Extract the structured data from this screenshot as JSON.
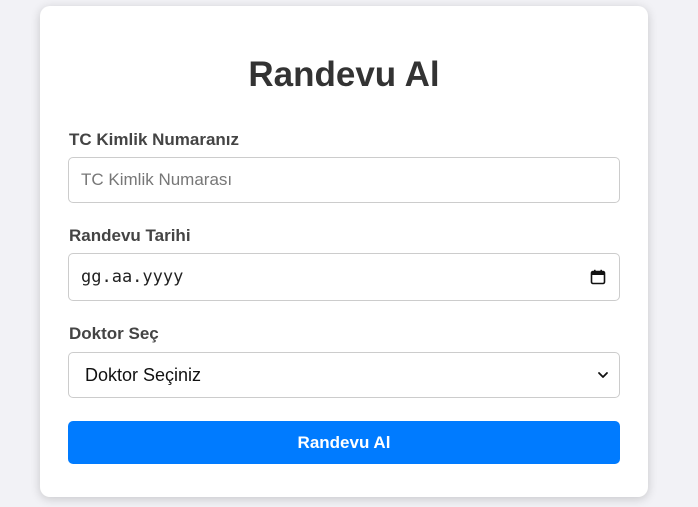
{
  "form": {
    "title": "Randevu Al",
    "tc_label": "TC Kimlik Numaranız",
    "tc_placeholder": "TC Kimlik Numarası",
    "tc_value": "",
    "date_label": "Randevu Tarihi",
    "date_placeholder": "gg.aa.yyyy",
    "doctor_label": "Doktor Seç",
    "doctor_selected": "Doktor Seçiniz",
    "submit_label": "Randevu Al"
  },
  "icons": {
    "date": "calendar-icon",
    "select": "chevron-down-icon"
  },
  "colors": {
    "accent": "#007bff",
    "background": "#f2f2f6",
    "card": "#ffffff",
    "title": "#333333"
  }
}
